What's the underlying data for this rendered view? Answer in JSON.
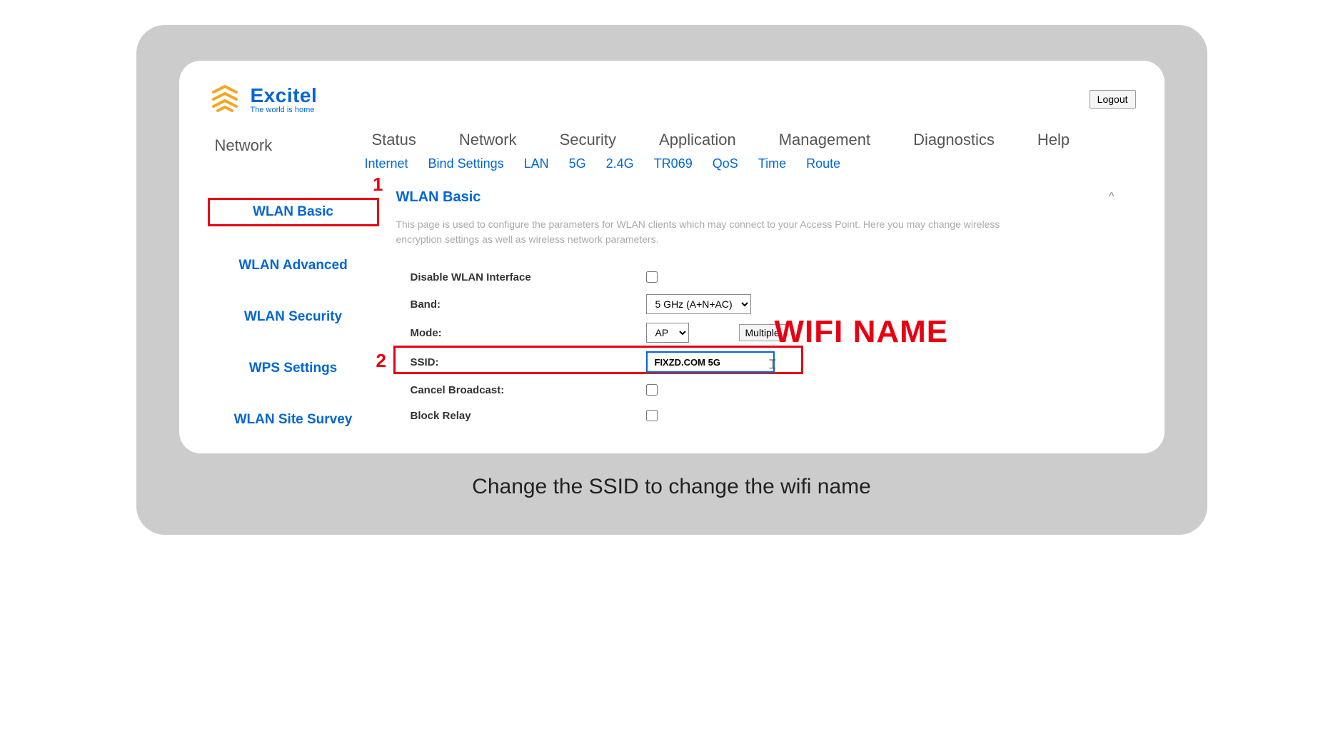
{
  "brand": {
    "name": "Excitel",
    "tagline": "The world is home"
  },
  "header": {
    "logout": "Logout"
  },
  "nav": {
    "section": "Network",
    "tabs": [
      "Status",
      "Network",
      "Security",
      "Application",
      "Management",
      "Diagnostics",
      "Help"
    ],
    "subtabs": [
      "Internet",
      "Bind Settings",
      "LAN",
      "5G",
      "2.4G",
      "TR069",
      "QoS",
      "Time",
      "Route"
    ]
  },
  "side": {
    "items": [
      "WLAN Basic",
      "WLAN Advanced",
      "WLAN Security",
      "WPS Settings",
      "WLAN Site Survey"
    ]
  },
  "panel": {
    "title": "WLAN Basic",
    "desc": "This page is used to configure the parameters for WLAN clients which may connect to your Access Point. Here you may change wireless encryption settings as well as wireless network parameters.",
    "collapse_icon": "^"
  },
  "form": {
    "disable_label": "Disable WLAN Interface",
    "band_label": "Band:",
    "band_value": "5 GHz (A+N+AC)",
    "mode_label": "Mode:",
    "mode_value": "AP",
    "multiple_btn": "Multiple",
    "ssid_label": "SSID:",
    "ssid_value": "FIXZD.COM 5G",
    "cancel_broadcast_label": "Cancel Broadcast:",
    "block_relay_label": "Block Relay"
  },
  "annotations": {
    "num1": "1",
    "num2": "2",
    "wifi_name": "WIFI NAME"
  },
  "caption": "Change the SSID to change the wifi name"
}
